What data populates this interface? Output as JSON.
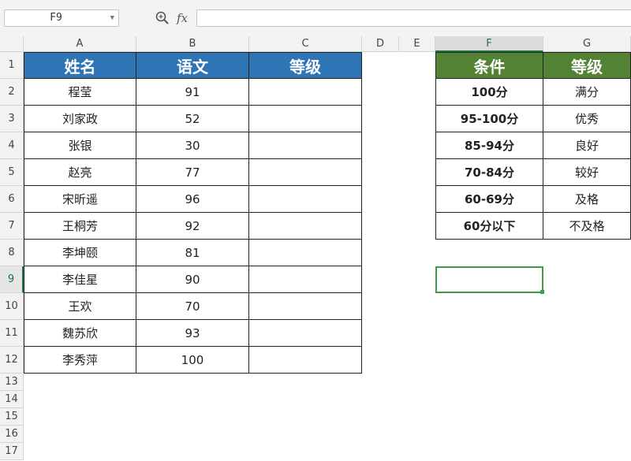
{
  "formula_bar": {
    "name_box": "F9",
    "fx_label": "fx",
    "formula": ""
  },
  "colors": {
    "header_blue": "#2f74b5",
    "header_green": "#548235",
    "selection_green": "#3f9a48"
  },
  "columns": [
    "A",
    "B",
    "C",
    "D",
    "E",
    "F",
    "G"
  ],
  "rows": [
    "1",
    "2",
    "3",
    "4",
    "5",
    "6",
    "7",
    "8",
    "9",
    "10",
    "11",
    "12",
    "13",
    "14",
    "15",
    "16",
    "17"
  ],
  "active_cell": {
    "column": "F",
    "row": "9"
  },
  "left_table": {
    "headers": [
      "姓名",
      "语文",
      "等级"
    ],
    "rows": [
      [
        "程莹",
        "91",
        ""
      ],
      [
        "刘家政",
        "52",
        ""
      ],
      [
        "张银",
        "30",
        ""
      ],
      [
        "赵亮",
        "77",
        ""
      ],
      [
        "宋昕遥",
        "96",
        ""
      ],
      [
        "王桐芳",
        "92",
        ""
      ],
      [
        "李坤颐",
        "81",
        ""
      ],
      [
        "李佳星",
        "90",
        ""
      ],
      [
        "王欢",
        "70",
        ""
      ],
      [
        "魏苏欣",
        "93",
        ""
      ],
      [
        "李秀萍",
        "100",
        ""
      ]
    ]
  },
  "right_table": {
    "headers": [
      "条件",
      "等级"
    ],
    "rows": [
      [
        "100分",
        "满分"
      ],
      [
        "95-100分",
        "优秀"
      ],
      [
        "85-94分",
        "良好"
      ],
      [
        "70-84分",
        "较好"
      ],
      [
        "60-69分",
        "及格"
      ],
      [
        "60分以下",
        "不及格"
      ]
    ]
  }
}
